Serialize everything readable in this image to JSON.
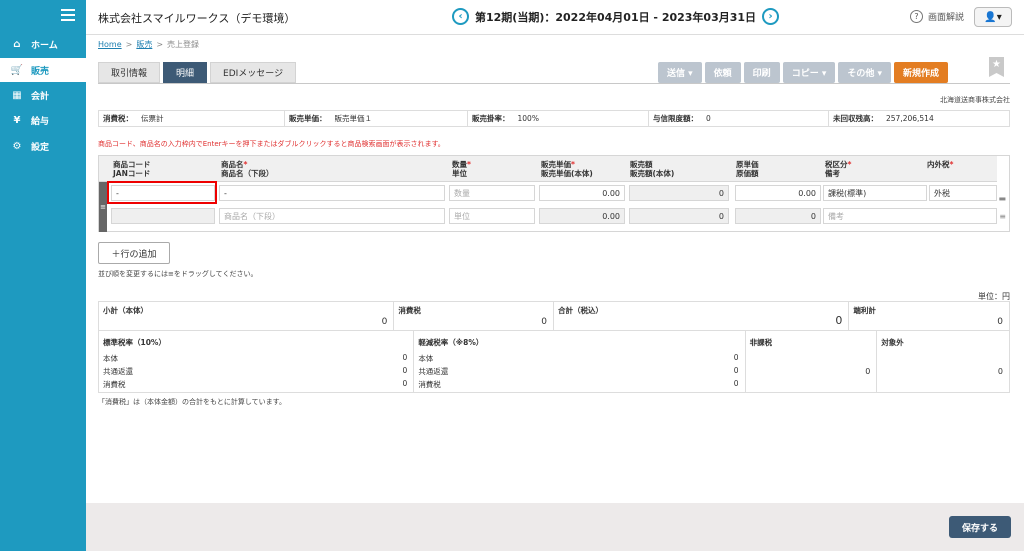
{
  "sidebar": {
    "items": [
      {
        "icon": "home-icon",
        "glyph": "⌂",
        "label": "ホーム"
      },
      {
        "icon": "cart-icon",
        "glyph": "🛒",
        "label": "販売"
      },
      {
        "icon": "calculator-icon",
        "glyph": "▦",
        "label": "会計"
      },
      {
        "icon": "money-bag-icon",
        "glyph": "¥",
        "label": "給与"
      },
      {
        "icon": "gear-icon",
        "glyph": "⚙",
        "label": "設定"
      }
    ]
  },
  "header": {
    "company": "株式会社スマイルワークス（デモ環境）",
    "period": "第12期(当期)：2022年04月01日 - 2023年03月31日",
    "prev": "‹",
    "next": "›",
    "help": "画面解説",
    "help_q": "?",
    "user": "👤▾"
  },
  "breadcrumb": {
    "home": "Home",
    "sales": "販売",
    "current": "売上登録",
    "sep": ">"
  },
  "tabs": [
    "取引情報",
    "明細",
    "EDIメッセージ"
  ],
  "actions": {
    "send": "送信 ▾",
    "request": "依頼",
    "print": "印刷",
    "copy": "コピー ▾",
    "other": "その他 ▾",
    "new": "新規作成"
  },
  "star": "★",
  "customer": "北海道送商事株式会社",
  "info": {
    "tax_label": "消費税：",
    "tax_value": "伝票計",
    "price_label": "販売単価：",
    "price_value": "販売単価１",
    "rate_label": "販売掛率：",
    "rate_value": "100%",
    "credit_label": "与信限度額：",
    "credit_value": "0",
    "uncollected_label": "未回収残高：",
    "uncollected_value": "257,206,514"
  },
  "warning": "商品コード、商品名の入力枠内でEnterキーを押下またはダブルクリックすると商品検索画面が表示されます。",
  "grid": {
    "h_code": "商品コード",
    "h_jan": "JANコード",
    "h_name": "商品名",
    "h_name2": "商品名（下段）",
    "h_qty": "数量",
    "h_unit": "単位",
    "h_price": "販売単価",
    "h_price2": "販売単価(本体)",
    "h_amount": "販売額",
    "h_amount2": "販売額(本体)",
    "h_cost": "原単価",
    "h_cost2": "原価額",
    "h_taxcat": "税区分",
    "h_remark": "備考",
    "h_taxtype": "内外税",
    "req": "*",
    "drag": "≡",
    "code": "-",
    "name": "-",
    "qty_ph": "数量",
    "name2_ph": "商品名（下段）",
    "unit_ph": "単位",
    "price": "0.00",
    "amount": "0",
    "cost": "0.00",
    "price2": "0.00",
    "amount2": "0",
    "cost2": "0",
    "taxcat": "課税(標準)",
    "taxtype": "外税",
    "remark_ph": "備考",
    "side1": "▬",
    "side2": "≡"
  },
  "add_row": "＋行の追加",
  "hint": "並び順を変更するには≡をドラッグしてください。",
  "unit_label": "単位：円",
  "totals": {
    "subtotal_label": "小計（本体）",
    "subtotal": "0",
    "tax_label": "消費税",
    "tax": "0",
    "total_label": "合計（税込）",
    "total": "0",
    "rounding_label": "端利計",
    "rounding": "0"
  },
  "taxrate": {
    "std_label": "標準税率（10%）",
    "red_label": "軽減税率（※8%）",
    "rows": [
      "本体",
      "共通返還",
      "消費税"
    ],
    "std_values": [
      "0",
      "0",
      "0"
    ],
    "red_values": [
      "0",
      "0",
      "0"
    ],
    "nontax_label": "非課税",
    "nontax": "0",
    "exempt_label": "対象外",
    "exempt": "0"
  },
  "note": "「消費税」は（本体金額）の合計をもとに計算しています。",
  "save": "保存する"
}
